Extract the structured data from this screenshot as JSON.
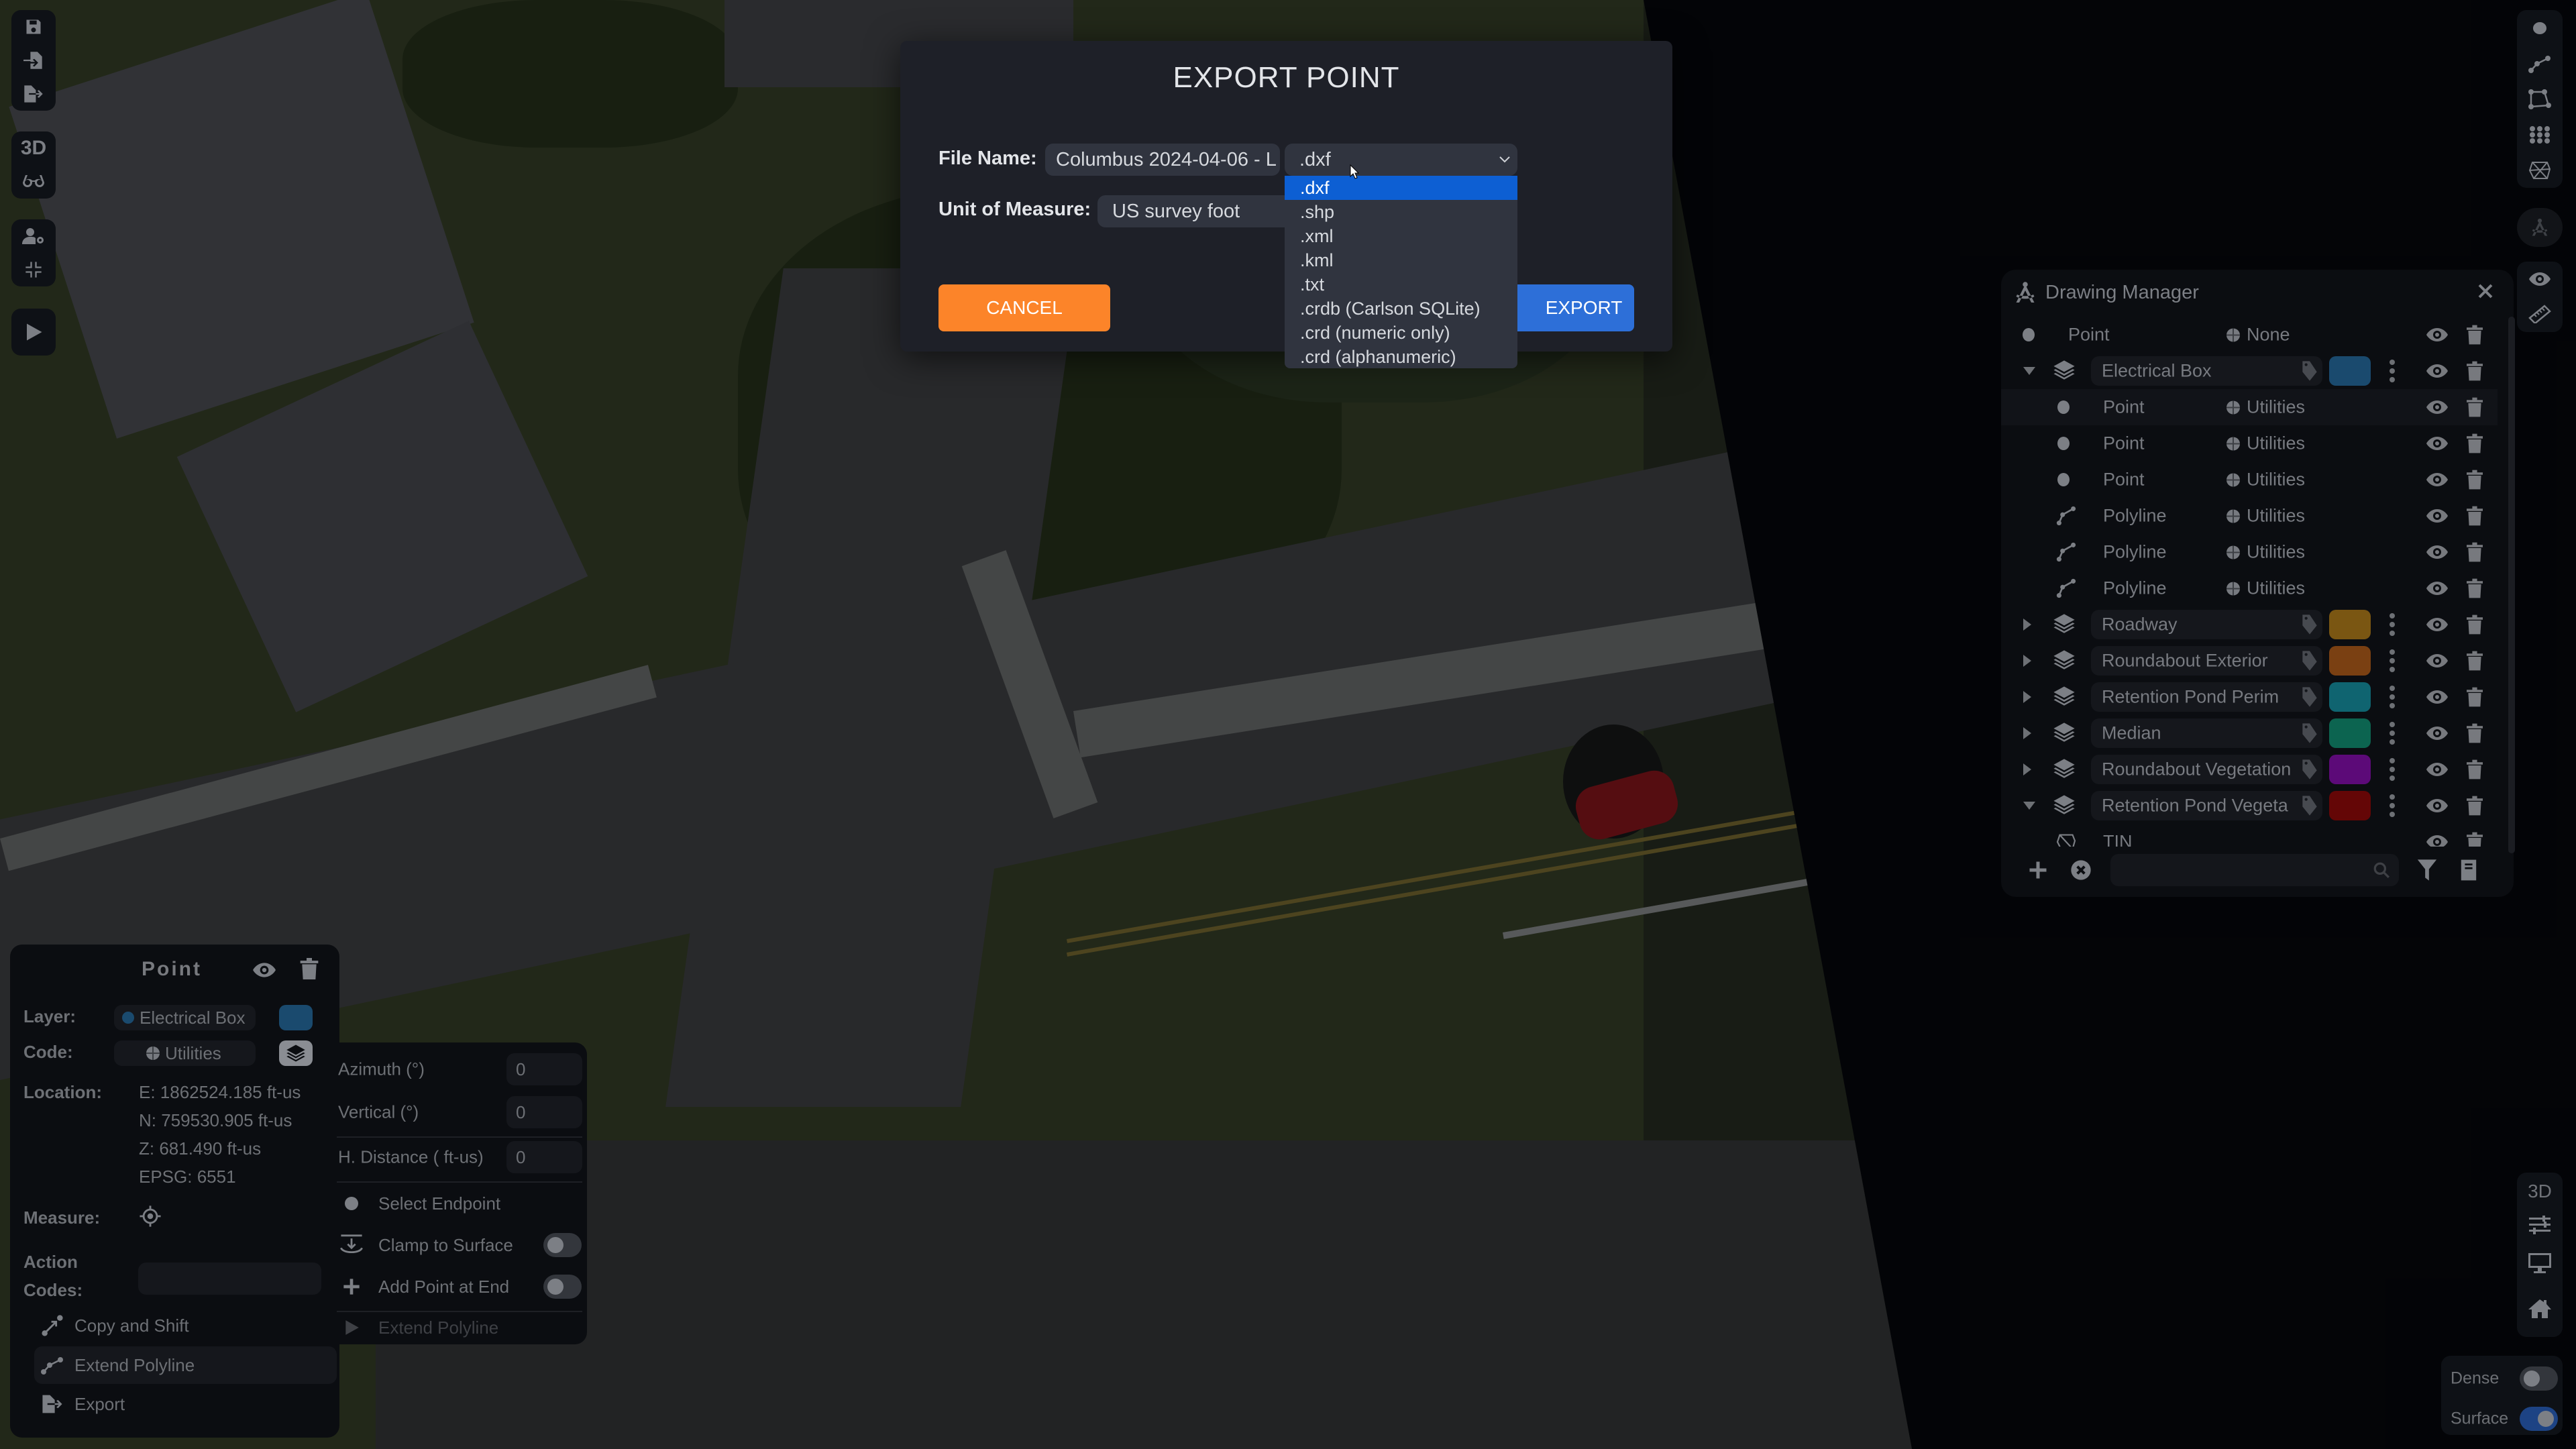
{
  "left_toolbar": {
    "file_group": [
      {
        "icon": "save-icon",
        "label": "Save"
      },
      {
        "icon": "import-file-icon",
        "label": "Import"
      },
      {
        "icon": "export-file-icon",
        "label": "Export"
      }
    ],
    "view_group": [
      {
        "icon": "3d-text-icon",
        "text": "3D"
      },
      {
        "icon": "glasses-icon"
      }
    ],
    "user_group": [
      {
        "icon": "user-settings-icon"
      },
      {
        "icon": "compress-icon"
      }
    ],
    "play_group": [
      {
        "icon": "play-icon"
      }
    ]
  },
  "export_dialog": {
    "title": "EXPORT POINT",
    "file_name_label": "File Name:",
    "file_name_value": "Columbus 2024-04-06 - L",
    "extension_selected": ".dxf",
    "extension_options": [
      ".dxf",
      ".shp",
      ".xml",
      ".kml",
      ".txt",
      ".crdb (Carlson SQLite)",
      ".crd (numeric only)",
      ".crd (alphanumeric)"
    ],
    "unit_label": "Unit of Measure:",
    "unit_value": "US survey foot",
    "cancel_label": "CANCEL",
    "export_label": "EXPORT",
    "colors": {
      "cancel": "#fc8429",
      "export": "#2d6fd8",
      "highlight": "#0d5fd3"
    }
  },
  "drawing_manager": {
    "title": "Drawing Manager",
    "rows": [
      {
        "type": "point",
        "name": "Point",
        "code": "None",
        "level": 0
      },
      {
        "type": "layer",
        "name": "Electrical Box",
        "color": "#1a4a6e",
        "expanded": true
      },
      {
        "type": "point",
        "name": "Point",
        "code": "Utilities",
        "level": 1,
        "highlight": true
      },
      {
        "type": "point",
        "name": "Point",
        "code": "Utilities",
        "level": 1
      },
      {
        "type": "point",
        "name": "Point",
        "code": "Utilities",
        "level": 1
      },
      {
        "type": "polyline",
        "name": "Polyline",
        "code": "Utilities",
        "level": 1
      },
      {
        "type": "polyline",
        "name": "Polyline",
        "code": "Utilities",
        "level": 1
      },
      {
        "type": "polyline",
        "name": "Polyline",
        "code": "Utilities",
        "level": 1
      },
      {
        "type": "layer",
        "name": "Roadway",
        "color": "#7a5612",
        "expanded": false
      },
      {
        "type": "layer",
        "name": "Roundabout Exterior",
        "color": "#7a4012",
        "expanded": false
      },
      {
        "type": "layer",
        "name": "Retention Pond Perim",
        "color": "#0f6470",
        "expanded": false
      },
      {
        "type": "layer",
        "name": "Median",
        "color": "#0c6450",
        "expanded": false
      },
      {
        "type": "layer",
        "name": "Roundabout Vegetation",
        "color": "#5c0a78",
        "expanded": false
      },
      {
        "type": "layer",
        "name": "Retention Pond Vegeta",
        "color": "#640606",
        "expanded": true
      },
      {
        "type": "tin",
        "name": "TIN",
        "level": 1
      }
    ],
    "search_placeholder": ""
  },
  "right_toolbar": {
    "draw_group": [
      "point-tool-icon",
      "polyline-tool-icon",
      "polygon-tool-icon",
      "grid-points-icon",
      "tin-mesh-icon"
    ],
    "manager_button": "drawing-manager-icon",
    "view_group": [
      "visibility-icon",
      "measure-ruler-icon"
    ],
    "bottom_group": {
      "text_3d": "3D",
      "icons": [
        "sliders-icon",
        "monitor-icon",
        "home-icon"
      ]
    }
  },
  "view_toggles": [
    {
      "label": "Dense",
      "on": false
    },
    {
      "label": "Surface",
      "on": true
    }
  ],
  "point_panel": {
    "title": "Point",
    "layer_label": "Layer:",
    "layer_value": "Electrical Box",
    "layer_color": "#1a4a6e",
    "code_label": "Code:",
    "code_value": "Utilities",
    "location_label": "Location:",
    "location": {
      "e": "E: 1862524.185 ft-us",
      "n": "N: 759530.905 ft-us",
      "z": "Z: 681.490 ft-us",
      "epsg": "EPSG: 6551"
    },
    "measure_label": "Measure:",
    "action_codes_label_1": "Action",
    "action_codes_label_2": "Codes:",
    "action_codes_value": "",
    "actions": [
      {
        "label": "Copy and Shift",
        "icon": "copy-shift-icon"
      },
      {
        "label": "Extend Polyline",
        "icon": "polyline-icon",
        "active": true
      },
      {
        "label": "Export",
        "icon": "export-file-icon"
      }
    ]
  },
  "offset_panel": {
    "azimuth_label": "Azimuth (°)",
    "azimuth_value": "0",
    "vertical_label": "Vertical (°)",
    "vertical_value": "0",
    "hdist_label": "H. Distance ( ft-us)",
    "hdist_value": "0",
    "select_endpoint_label": "Select Endpoint",
    "clamp_label": "Clamp to Surface",
    "clamp_on": false,
    "add_point_label": "Add Point at End",
    "add_point_on": false,
    "extend_label": "Extend Polyline"
  }
}
